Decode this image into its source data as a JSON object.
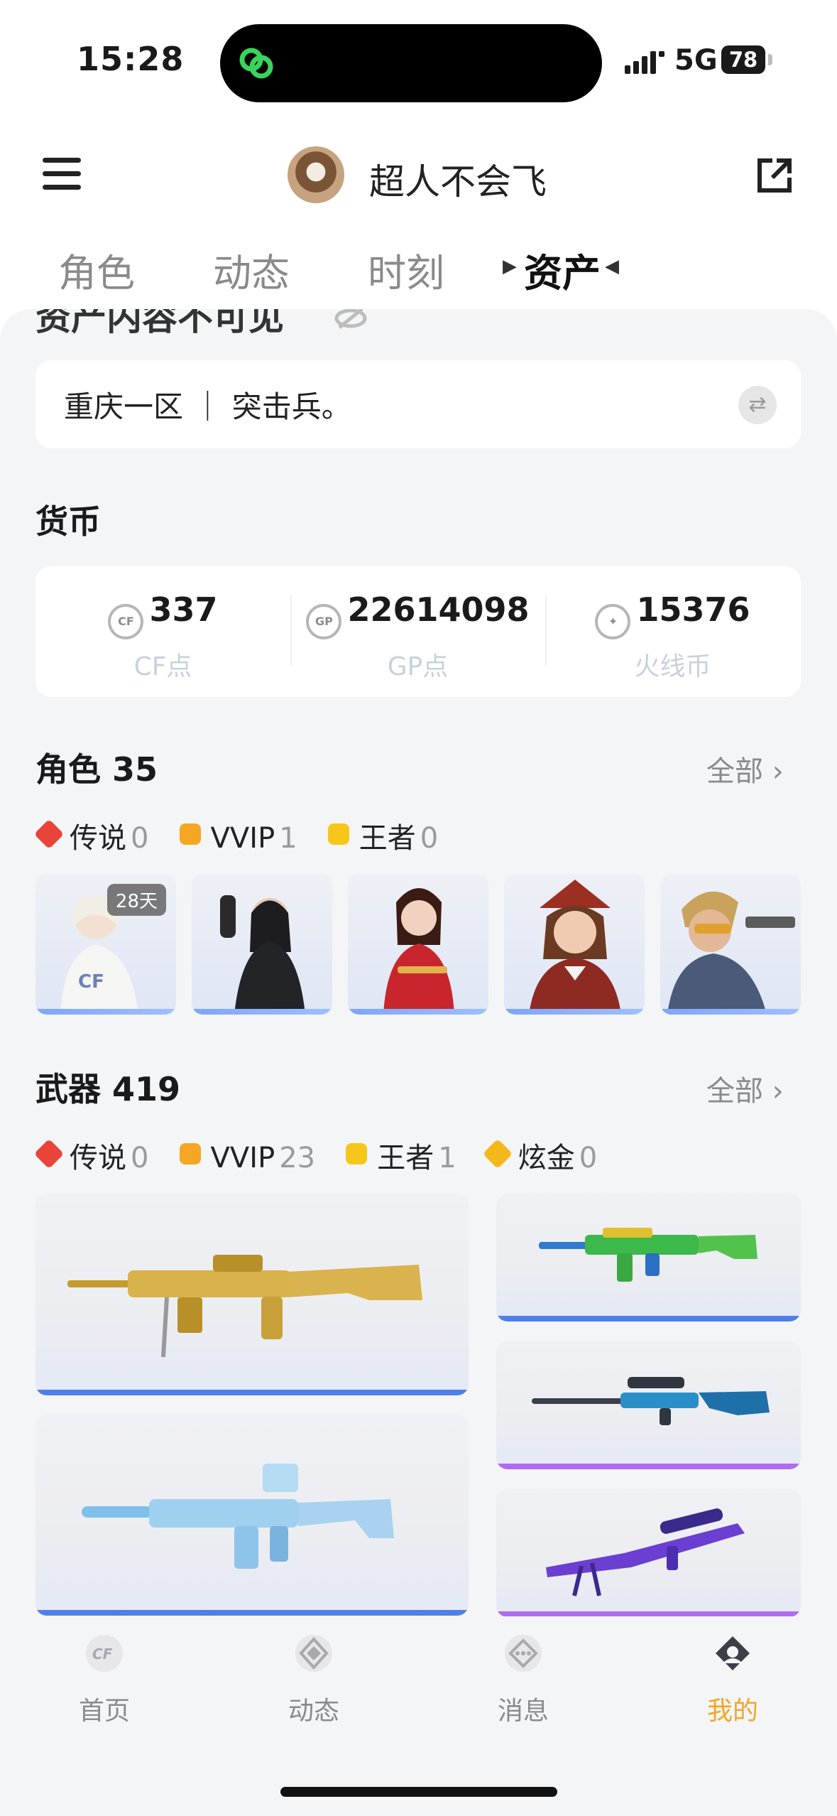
{
  "status": {
    "time": "15:28",
    "network": "5G",
    "battery": "78"
  },
  "header": {
    "username": "超人不会飞"
  },
  "tabs": [
    {
      "label": "角色",
      "active": false
    },
    {
      "label": "动态",
      "active": false
    },
    {
      "label": "时刻",
      "active": false
    },
    {
      "label": "资产",
      "active": true
    }
  ],
  "notice_partial": "资产内容不可见",
  "server": {
    "text": "重庆一区 ｜ 突击兵。"
  },
  "currency": {
    "title": "货币",
    "items": [
      {
        "value": "337",
        "label": "CF点",
        "icon": "cf-coin-icon"
      },
      {
        "value": "22614098",
        "label": "GP点",
        "icon": "gp-coin-icon"
      },
      {
        "value": "15376",
        "label": "火线币",
        "icon": "cf-currency-icon"
      }
    ]
  },
  "characters": {
    "title": "角色 35",
    "all_label": "全部",
    "rarities": [
      {
        "label": "传说",
        "count": "0",
        "color": "#e8443a"
      },
      {
        "label": "VVIP",
        "count": "1",
        "color": "#f5a623"
      },
      {
        "label": "王者",
        "count": "0",
        "color": "#f7c61b"
      }
    ],
    "cards": [
      {
        "name": "white-outfit-character",
        "badge": "28天"
      },
      {
        "name": "black-suit-character",
        "badge": ""
      },
      {
        "name": "red-dress-character",
        "badge": ""
      },
      {
        "name": "officer-character",
        "badge": ""
      },
      {
        "name": "blonde-gunman-character",
        "badge": ""
      }
    ]
  },
  "weapons": {
    "title": "武器 419",
    "all_label": "全部",
    "rarities": [
      {
        "label": "传说",
        "count": "0",
        "color": "#e8443a"
      },
      {
        "label": "VVIP",
        "count": "23",
        "color": "#f5a623"
      },
      {
        "label": "王者",
        "count": "1",
        "color": "#f7c61b"
      },
      {
        "label": "炫金",
        "count": "0",
        "color": "#f5b81c"
      }
    ],
    "accent_blue": "#4f7fe8",
    "accent_purple": "#b06cf0"
  },
  "nav": [
    {
      "label": "首页",
      "icon": "home-icon",
      "active": false
    },
    {
      "label": "动态",
      "icon": "activity-icon",
      "active": false
    },
    {
      "label": "消息",
      "icon": "message-icon",
      "active": false
    },
    {
      "label": "我的",
      "icon": "profile-icon",
      "active": true
    }
  ]
}
